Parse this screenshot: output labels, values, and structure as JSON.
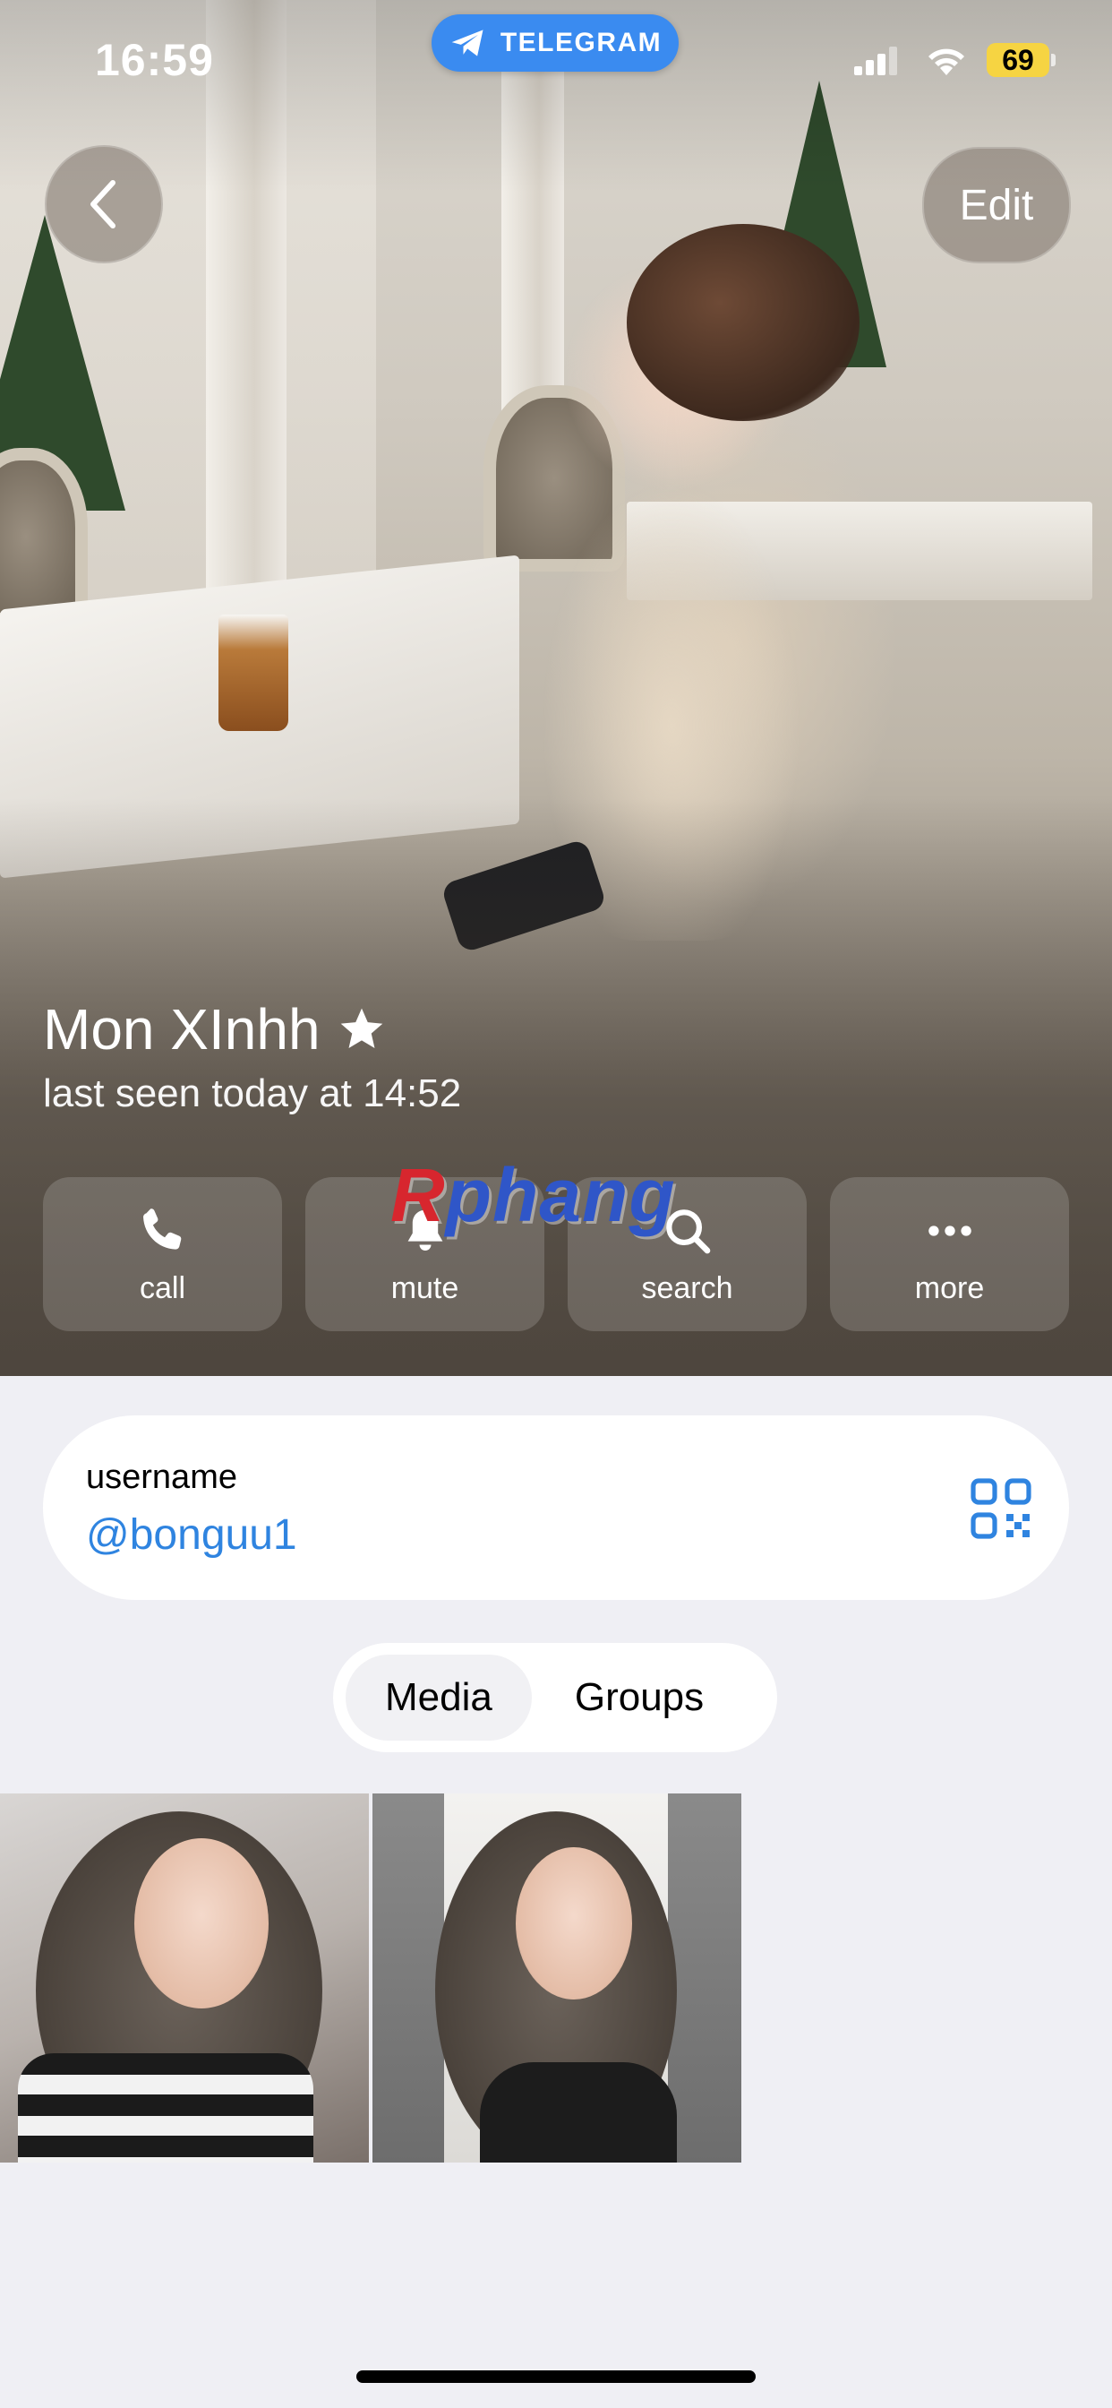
{
  "status_bar": {
    "time": "16:59",
    "app_pill": "TELEGRAM",
    "battery": "69"
  },
  "nav": {
    "edit_label": "Edit"
  },
  "profile": {
    "name": "Mon XInhh",
    "last_seen": "last seen today at 14:52"
  },
  "actions": [
    {
      "label": "call",
      "icon": "phone-icon"
    },
    {
      "label": "mute",
      "icon": "bell-icon"
    },
    {
      "label": "search",
      "icon": "search-icon"
    },
    {
      "label": "more",
      "icon": "more-icon"
    }
  ],
  "watermark": {
    "first_letter": "R",
    "rest": "phang"
  },
  "username_card": {
    "label": "username",
    "value": "@bonguu1"
  },
  "tabs": [
    {
      "label": "Media",
      "selected": true
    },
    {
      "label": "Groups",
      "selected": false
    }
  ],
  "colors": {
    "accent": "#2f84e0",
    "telegram_pill": "#3a8bf0",
    "battery": "#f6d442",
    "background": "#efeff4"
  }
}
